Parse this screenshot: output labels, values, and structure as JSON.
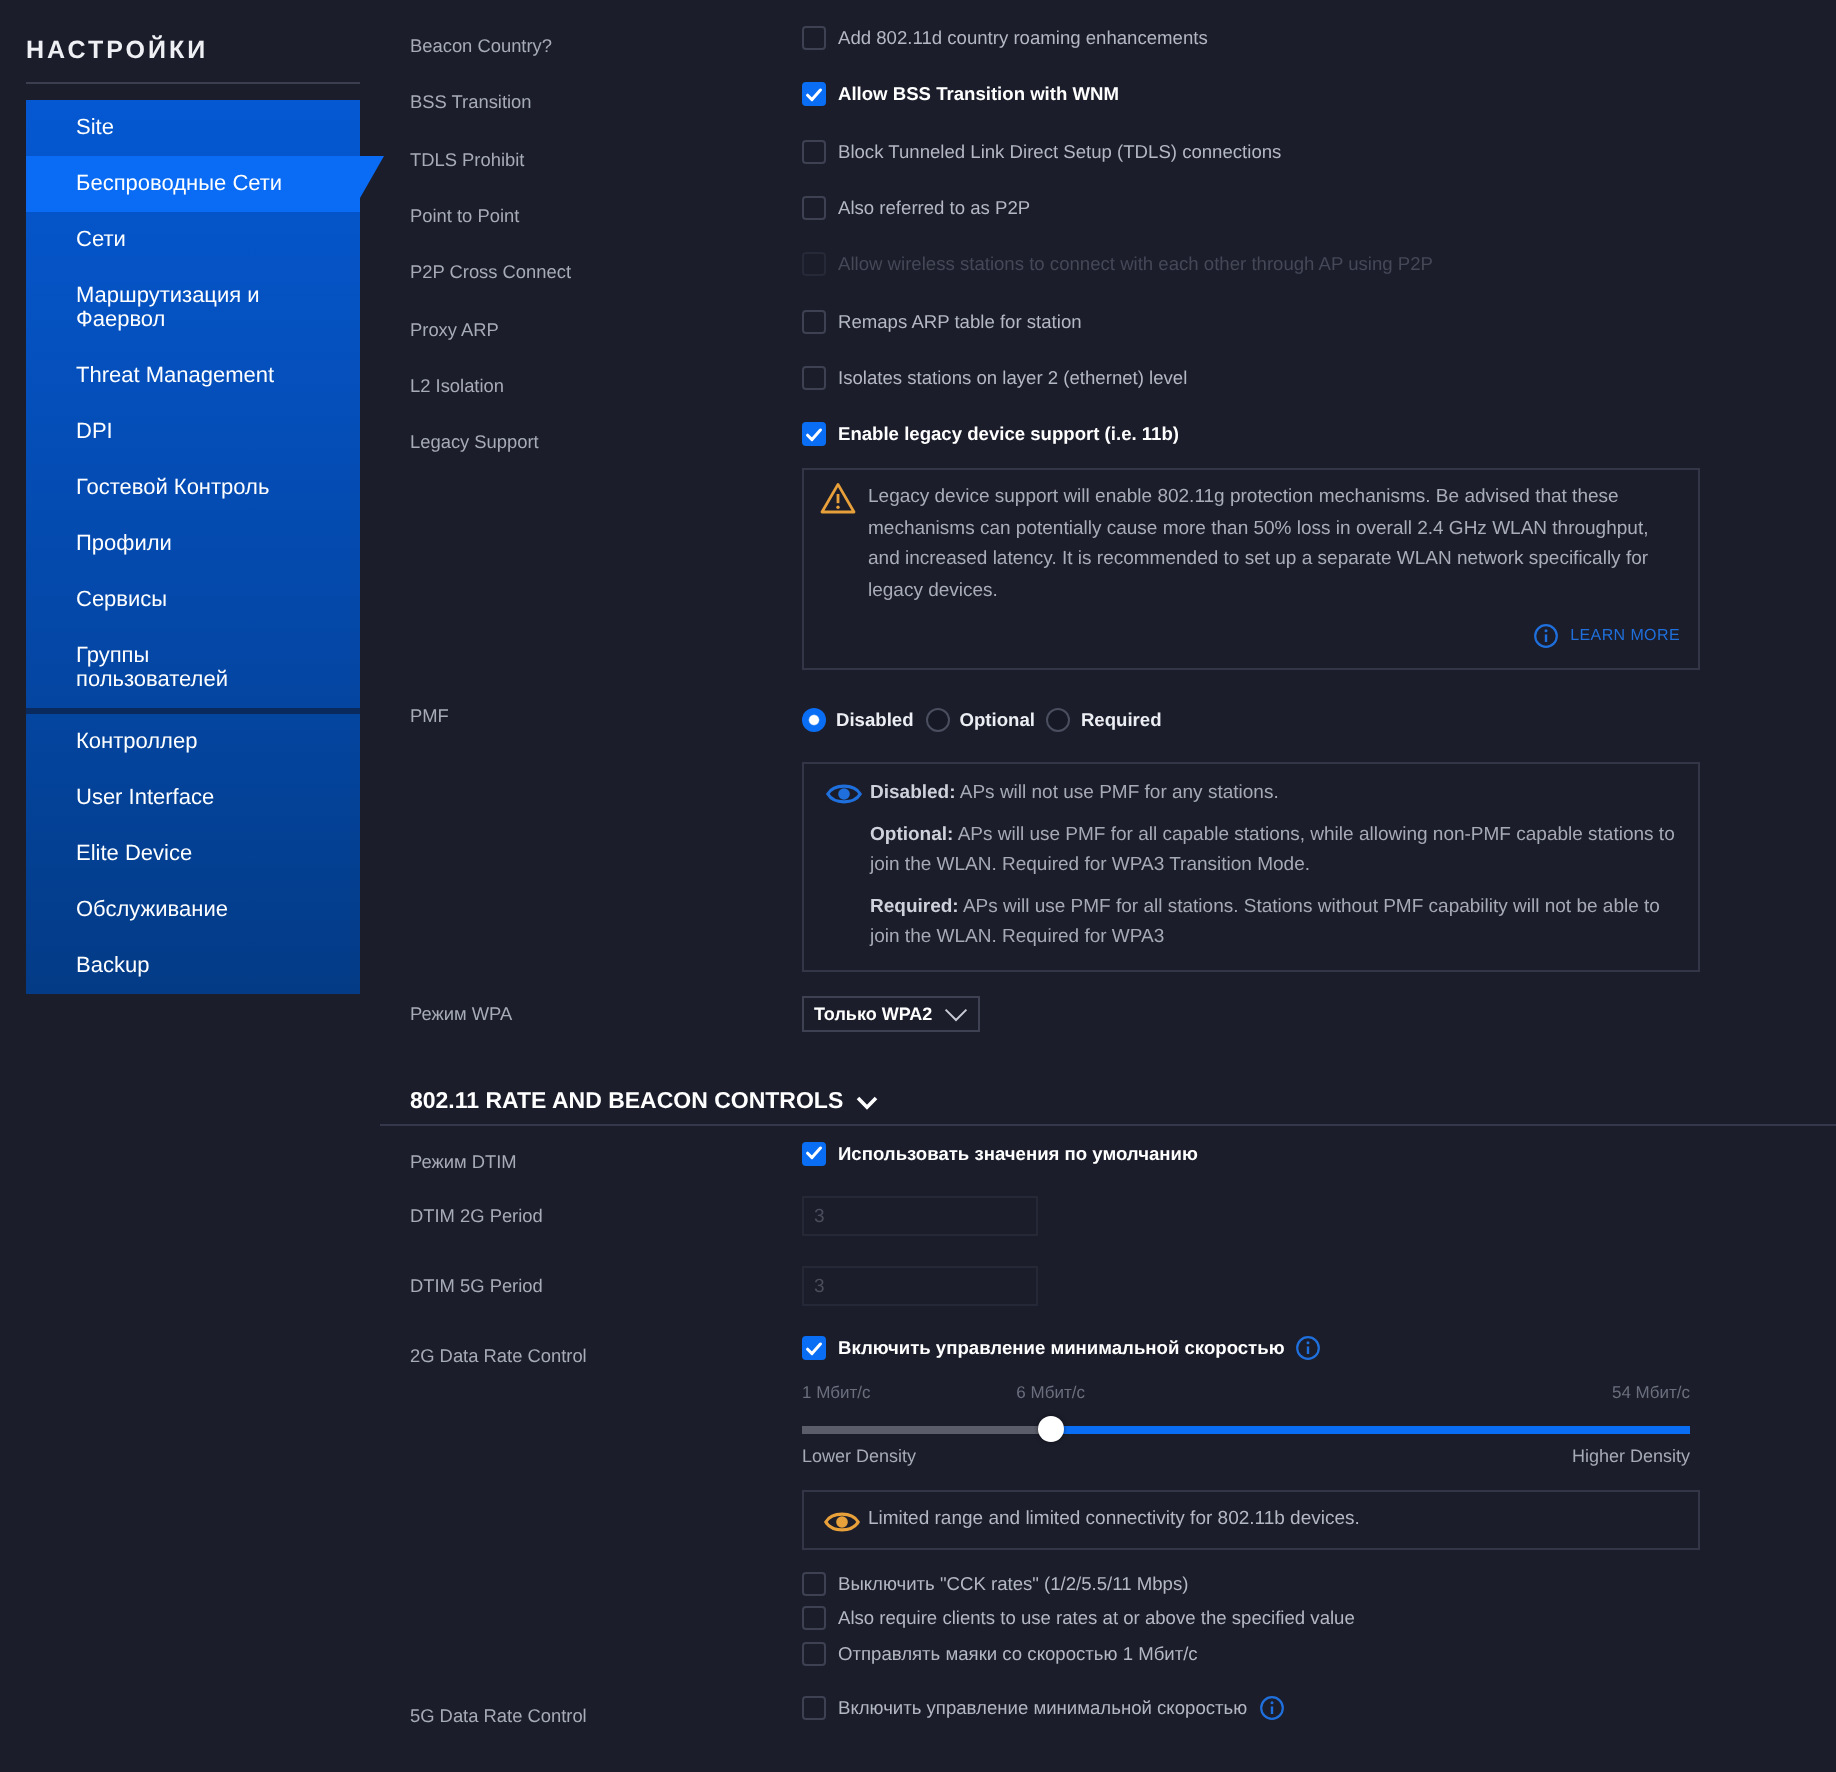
{
  "sidebar": {
    "title": "НАСТРОЙКИ",
    "groups": [
      {
        "items": [
          {
            "label": "Site",
            "selected": false
          },
          {
            "label": "Беспроводные Сети",
            "selected": true
          },
          {
            "label": "Сети",
            "selected": false
          },
          {
            "label": "Маршрутизация и Фаервол",
            "selected": false
          },
          {
            "label": "Threat Management",
            "selected": false
          },
          {
            "label": "DPI",
            "selected": false
          },
          {
            "label": "Гостевой Контроль",
            "selected": false
          },
          {
            "label": "Профили",
            "selected": false
          },
          {
            "label": "Сервисы",
            "selected": false
          },
          {
            "label": "Группы пользователей",
            "selected": false
          }
        ]
      },
      {
        "items": [
          {
            "label": "Контроллер",
            "selected": false
          },
          {
            "label": "User Interface",
            "selected": false
          },
          {
            "label": "Elite Device",
            "selected": false
          },
          {
            "label": "Обслуживание",
            "selected": false
          },
          {
            "label": "Backup",
            "selected": false
          }
        ]
      }
    ]
  },
  "wireless_options": [
    {
      "label": "Beacon Country?",
      "text": "Add 802.11d country roaming enhancements",
      "checked": false,
      "disabled": false
    },
    {
      "label": "BSS Transition",
      "text": "Allow BSS Transition with WNM",
      "checked": true,
      "disabled": false
    },
    {
      "label": "TDLS Prohibit",
      "text": "Block Tunneled Link Direct Setup (TDLS) connections",
      "checked": false,
      "disabled": false
    },
    {
      "label": "Point to Point",
      "text": "Also referred to as P2P",
      "checked": false,
      "disabled": false
    },
    {
      "label": "P2P Cross Connect",
      "text": "Allow wireless stations to connect with each other through AP using P2P",
      "checked": false,
      "disabled": true
    },
    {
      "label": "Proxy ARP",
      "text": "Remaps ARP table for station",
      "checked": false,
      "disabled": false
    },
    {
      "label": "L2 Isolation",
      "text": "Isolates stations on layer 2 (ethernet) level",
      "checked": false,
      "disabled": false
    },
    {
      "label": "Legacy Support",
      "text": "Enable legacy device support (i.e. 11b)",
      "checked": true,
      "disabled": false
    }
  ],
  "legacy_warning": {
    "text": "Legacy device support will enable 802.11g protection mechanisms. Be advised that these mechanisms can potentially cause more than 50% loss in overall 2.4 GHz WLAN throughput, and increased latency. It is recommended to set up a separate WLAN network specifically for legacy devices.",
    "link": "LEARN MORE"
  },
  "pmf": {
    "label": "PMF",
    "options": [
      {
        "label": "Disabled",
        "selected": true
      },
      {
        "label": "Optional",
        "selected": false
      },
      {
        "label": "Required",
        "selected": false
      }
    ],
    "info": [
      "**Disabled:** APs will not use PMF for any stations.",
      "**Optional:** APs will use PMF for all capable stations, while allowing non-PMF capable stations to join the WLAN. Required for WPA3 Transition Mode.",
      "**Required:** APs will use PMF for all stations. Stations without PMF capability will not be able to join the WLAN. Required for WPA3"
    ]
  },
  "wpa_mode": {
    "label": "Режим WPA",
    "value": "Только WPA2"
  },
  "rate_section": {
    "title": "802.11 RATE AND BEACON CONTROLS",
    "expanded": true,
    "dtim_mode": {
      "label": "Режим DTIM",
      "text": "Использовать значения по умолчанию",
      "checked": true
    },
    "dtim_periods": [
      {
        "label": "DTIM 2G Period",
        "value": "3",
        "disabled": true
      },
      {
        "label": "DTIM 5G Period",
        "value": "3",
        "disabled": true
      }
    ],
    "data_rate_controls": [
      {
        "label": "2G Data Rate Control",
        "text": "Включить управление минимальной скоростью",
        "checked": true,
        "slider": {
          "min_label": "1 Мбит/с",
          "value_label": "6 Мбит/с",
          "max_label": "54 Мбит/с",
          "level": 0.28,
          "low_label": "Lower Density",
          "high_label": "Higher Density"
        },
        "notice": "Limited range and limited connectivity for 802.11b devices.",
        "options": [
          {
            "text": "Выключить \"CCK rates\" (1/2/5.5/11 Mbps)",
            "checked": false
          },
          {
            "text": "Also require clients to use rates at or above the specified value",
            "checked": false
          },
          {
            "text": "Отправлять маяки со скоростью 1 Мбит/с",
            "checked": false
          }
        ]
      },
      {
        "label": "5G Data Rate Control",
        "text": "Включить управление минимальной скоростью",
        "checked": false
      }
    ]
  }
}
